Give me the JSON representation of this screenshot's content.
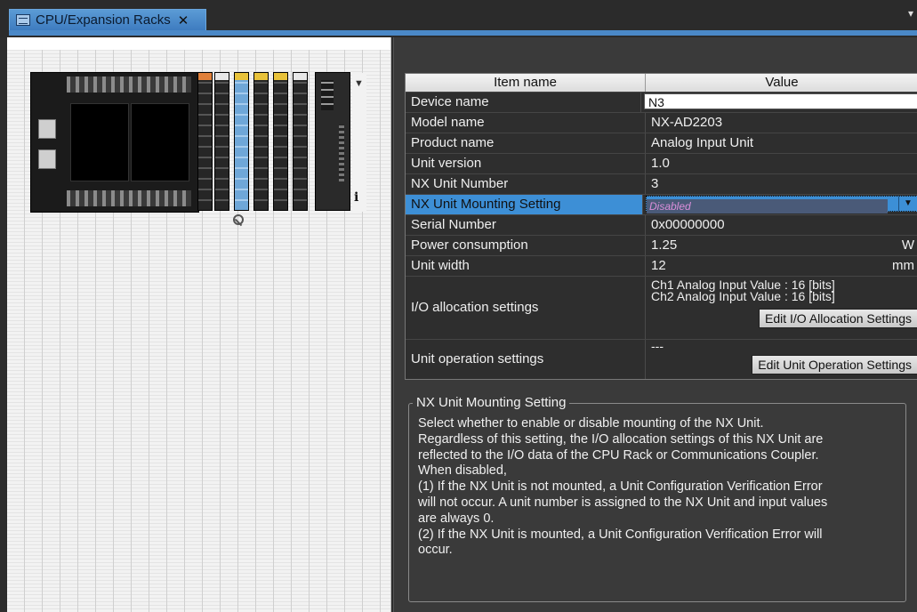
{
  "tab": {
    "title": "CPU/Expansion Racks",
    "close_glyph": "✕",
    "chevron_glyph": "▾"
  },
  "rack": {
    "info_glyph": "i",
    "scroll_glyph": "▼",
    "unit_cap_colors": [
      "#e0803a",
      "#e8e8e8",
      "#e8c23a",
      "#e8c23a",
      "#e8c23a",
      "#e8e8e8"
    ]
  },
  "properties": {
    "header": {
      "item_name": "Item name",
      "value": "Value"
    },
    "rows": [
      {
        "name": "Device name",
        "value": "N3"
      },
      {
        "name": "Model name",
        "value": "NX-AD2203"
      },
      {
        "name": "Product name",
        "value": "Analog Input Unit"
      },
      {
        "name": "Unit version",
        "value": "1.0"
      },
      {
        "name": "NX Unit Number",
        "value": "3"
      },
      {
        "name": "NX Unit Mounting Setting",
        "value": "Disabled",
        "dropdown_glyph": "▼"
      },
      {
        "name": "Serial Number",
        "value": "0x00000000"
      },
      {
        "name": "Power consumption",
        "value": "1.25",
        "unit": "W"
      },
      {
        "name": "Unit width",
        "value": "12",
        "unit": "mm"
      },
      {
        "name": "I/O allocation settings",
        "line1": "Ch1 Analog Input Value : 16 [bits]",
        "line2": "Ch2 Analog Input Value : 16 [bits]",
        "button": "Edit I/O Allocation Settings"
      },
      {
        "name": "Unit operation settings",
        "value": "---",
        "button": "Edit Unit Operation Settings"
      }
    ]
  },
  "description": {
    "title": "NX Unit Mounting Setting",
    "lines": [
      "Select whether to enable or disable mounting of the NX Unit.",
      "Regardless of this setting, the I/O allocation settings of this NX Unit are",
      "reflected to the I/O data of the CPU Rack or Communications Coupler.",
      "When disabled,",
      "(1) If the NX Unit is not mounted, a Unit Configuration Verification Error",
      "will not occur. A unit number is assigned to the NX Unit and input values",
      "are always 0.",
      "(2) If the NX Unit is mounted, a Unit Configuration Verification Error will",
      "occur."
    ]
  }
}
